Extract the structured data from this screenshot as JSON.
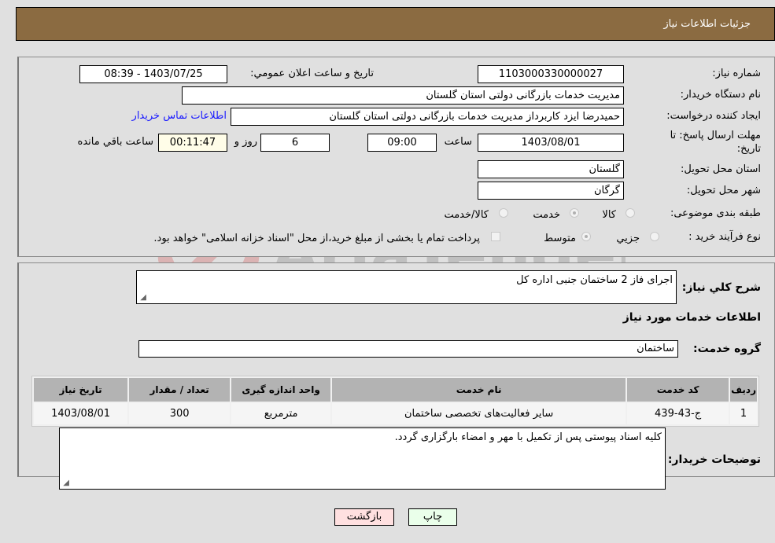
{
  "header": {
    "title": "جزئیات اطلاعات نیاز"
  },
  "details": {
    "need_number_label": "شماره نیاز:",
    "need_number": "1103000330000027",
    "announce_label": "تاریخ و ساعت اعلان عمومي:",
    "announce_value": "1403/07/25 - 08:39",
    "buyer_org_label": "نام دستگاه خریدار:",
    "buyer_org": "مدیریت خدمات بازرگانی دولتی استان گلستان",
    "creator_label": "ایجاد کننده درخواست:",
    "creator": "حمیدرضا ایزد کاربرداز مدیریت خدمات بازرگانی دولتی استان گلستان",
    "contact_link": "اطلاعات تماس خریدار",
    "deadline_label_1": "مهلت ارسال پاسخ: تا",
    "deadline_label_2": "تاریخ:",
    "deadline_date": "1403/08/01",
    "time_label": "ساعت",
    "deadline_time": "09:00",
    "days": "6",
    "days_label": "روز و",
    "remaining": "00:11:47",
    "remaining_label": "ساعت باقي مانده",
    "province_label": "استان محل تحویل:",
    "province": "گلستان",
    "city_label": "شهر محل تحویل:",
    "city": "گرگان",
    "category_label": "طبقه بندی موضوعی:",
    "category_options": [
      {
        "label": "کالا",
        "selected": false
      },
      {
        "label": "خدمت",
        "selected": true
      },
      {
        "label": "کالا/خدمت",
        "selected": false
      }
    ],
    "process_label": "نوع فرآیند خرید :",
    "process_options": [
      {
        "label": "جزيي",
        "selected": false
      },
      {
        "label": "متوسط",
        "selected": true
      }
    ],
    "treasury_note": "پرداخت تمام یا بخشی از مبلغ خرید،از محل \"اسناد خزانه اسلامی\" خواهد بود."
  },
  "summary": {
    "description_label": "شرح كلي نياز:",
    "description": "اجرای فاز 2 ساختمان جنبی اداره کل",
    "services_title": "اطلاعات خدمات مورد نياز",
    "service_group_label": "گروه خدمت:",
    "service_group": "ساختمان"
  },
  "table": {
    "headers": [
      "ردیف",
      "کد خدمت",
      "نام خدمت",
      "واحد اندازه گیری",
      "تعداد / مقدار",
      "تاریخ نیاز"
    ],
    "rows": [
      [
        "1",
        "ج-43-439",
        "سایر فعالیت‌های تخصصی ساختمان",
        "مترمربع",
        "300",
        "1403/08/01"
      ]
    ]
  },
  "buyer_notes": {
    "label": "توضیحات خریدار:",
    "text": "کلیه اسناد پیوستی پس از تکمیل با مهر و امضاء بارگزاری گردد."
  },
  "buttons": {
    "print": "چاپ",
    "back": "بازگشت"
  },
  "watermark": {
    "text": "AriaTender.neT"
  },
  "colors": {
    "header_bg": "#8b6b41",
    "print_bg": "#eaffea",
    "back_bg": "#ffe0e0",
    "link": "#1a1aff"
  }
}
